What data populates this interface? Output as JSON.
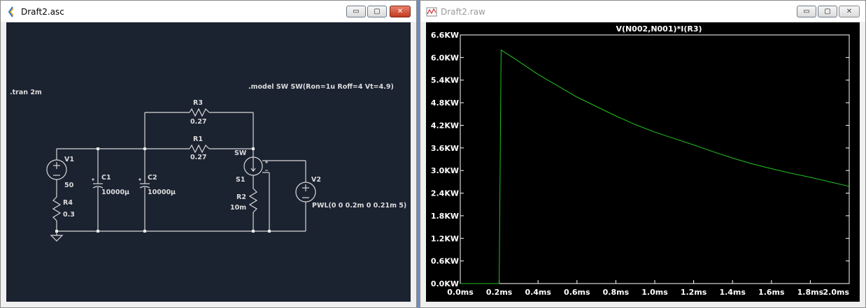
{
  "left_window": {
    "title": "Draft2.asc",
    "buttons": {
      "minimize": "▭",
      "maximize": "▢",
      "close": "✕"
    },
    "schematic": {
      "directives": {
        "tran": ".tran 2m",
        "model": ".model SW SW(Ron=1u Roff=4 Vt=4.9)"
      },
      "components": {
        "v1": {
          "name": "V1",
          "value": "50"
        },
        "r4": {
          "name": "R4",
          "value": "0.3"
        },
        "c1": {
          "name": "C1",
          "value": "10000µ"
        },
        "c2": {
          "name": "C2",
          "value": "10000µ"
        },
        "r3": {
          "name": "R3",
          "value": "0.27"
        },
        "r1": {
          "name": "R1",
          "value": "0.27"
        },
        "s1": {
          "name": "S1",
          "model": "SW"
        },
        "r2": {
          "name": "R2",
          "value": "10m"
        },
        "v2": {
          "name": "V2",
          "value": "PWL(0 0 0.2m 0 0.21m 5)"
        }
      }
    }
  },
  "right_window": {
    "title": "Draft2.raw",
    "buttons": {
      "minimize": "▭",
      "maximize": "▢",
      "close": "✕"
    },
    "trace_color": "#22c422",
    "chart_data": {
      "type": "line",
      "title": "V(N002,N001)*I(R3)",
      "x_unit": "ms",
      "xlim": [
        0.0,
        2.0
      ],
      "ylim": [
        0.0,
        6.6
      ],
      "x_ticks": [
        "0.0ms",
        "0.2ms",
        "0.4ms",
        "0.6ms",
        "0.8ms",
        "1.0ms",
        "1.2ms",
        "1.4ms",
        "1.6ms",
        "1.8ms",
        "2.0ms"
      ],
      "y_ticks": [
        "0.0KW",
        "0.6KW",
        "1.2KW",
        "1.8KW",
        "2.4KW",
        "3.0KW",
        "3.6KW",
        "4.2KW",
        "4.8KW",
        "5.4KW",
        "6.0KW",
        "6.6KW"
      ],
      "series": [
        {
          "x": [
            0.0,
            0.2,
            0.21,
            0.3,
            0.4,
            0.5,
            0.6,
            0.7,
            0.8,
            0.9,
            1.0,
            1.1,
            1.2,
            1.3,
            1.4,
            1.5,
            1.6,
            1.7,
            1.8,
            1.9,
            2.0
          ],
          "y": [
            0.0,
            0.0,
            6.2,
            5.9,
            5.55,
            5.25,
            4.95,
            4.7,
            4.45,
            4.22,
            4.02,
            3.85,
            3.68,
            3.5,
            3.33,
            3.18,
            3.05,
            2.93,
            2.82,
            2.7,
            2.58
          ]
        }
      ]
    }
  }
}
